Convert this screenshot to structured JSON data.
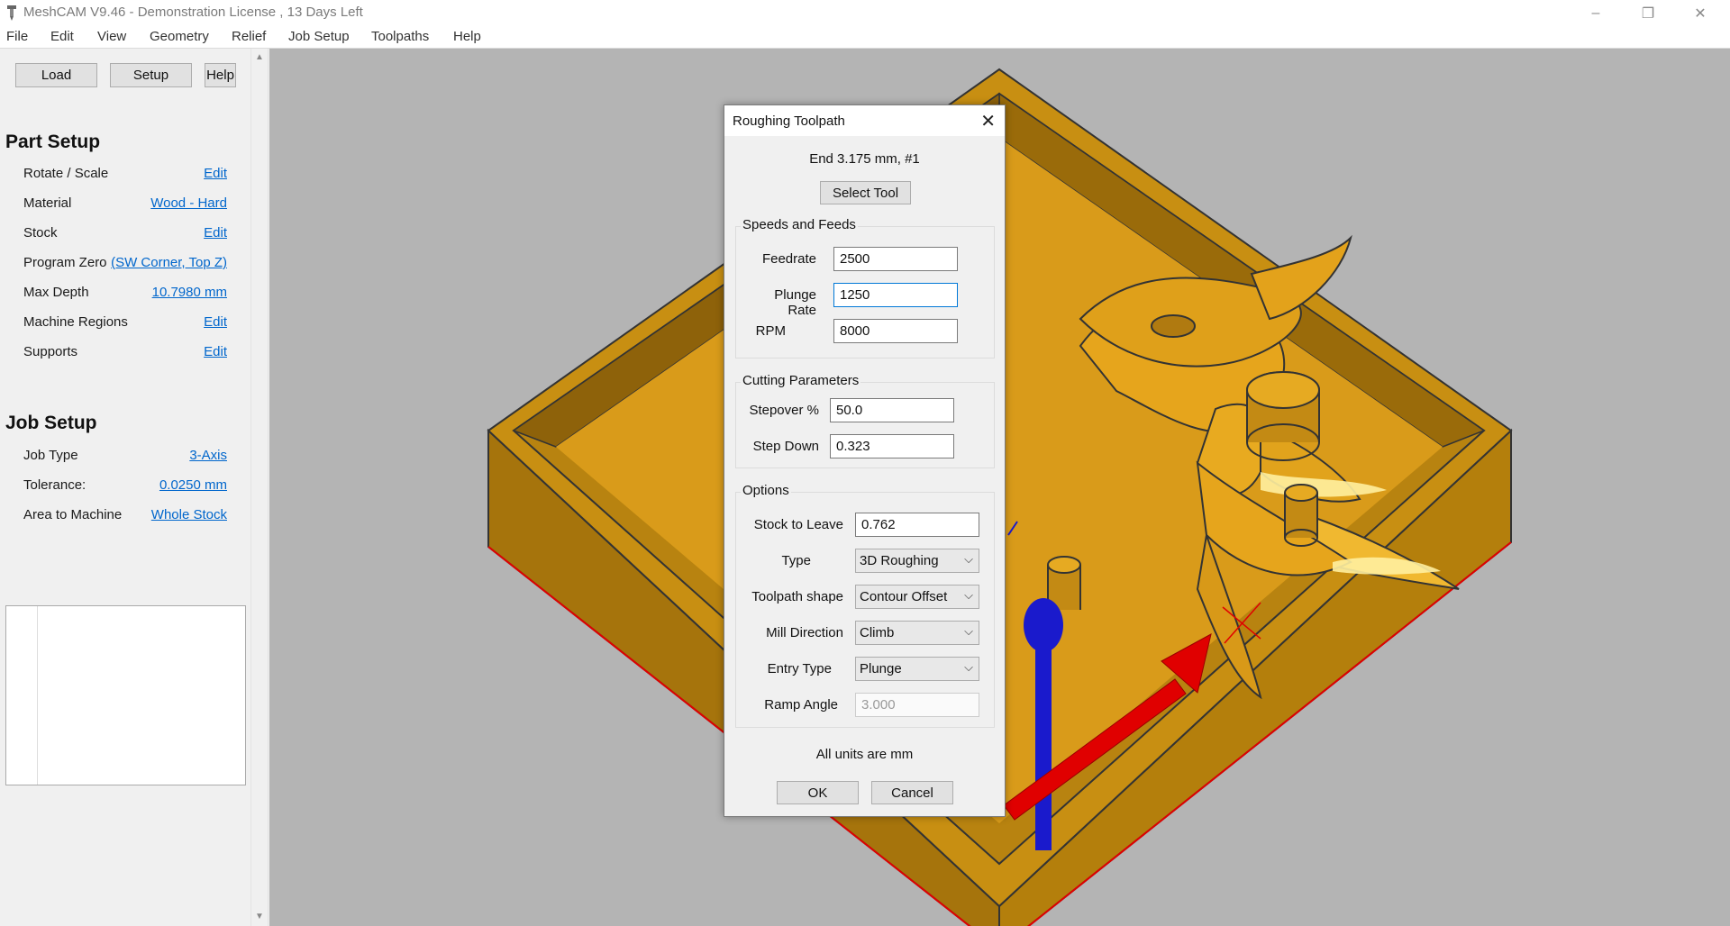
{
  "window": {
    "title": "MeshCAM V9.46 - Demonstration License  , 13 Days Left",
    "controls": [
      "–",
      "❐",
      "✕"
    ]
  },
  "menu": [
    "File",
    "Edit",
    "View",
    "Geometry",
    "Relief",
    "Job Setup",
    "Toolpaths",
    "Help"
  ],
  "toolbar": {
    "load": "Load",
    "setup": "Setup",
    "help": "Help"
  },
  "part_setup": {
    "title": "Part Setup",
    "rows": [
      {
        "label": "Rotate / Scale",
        "value": "Edit"
      },
      {
        "label": "Material",
        "value": "Wood - Hard"
      },
      {
        "label": "Stock",
        "value": "Edit"
      },
      {
        "label": "Program Zero",
        "value": " (SW Corner, Top Z)"
      },
      {
        "label": "Max Depth",
        "value": "10.7980 mm"
      },
      {
        "label": "Machine Regions",
        "value": "Edit"
      },
      {
        "label": "Supports",
        "value": "Edit"
      }
    ]
  },
  "job_setup": {
    "title": "Job Setup",
    "rows": [
      {
        "label": "Job Type",
        "value": "3-Axis"
      },
      {
        "label": "Tolerance:",
        "value": "0.0250 mm"
      },
      {
        "label": "Area to Machine",
        "value": "Whole Stock"
      }
    ]
  },
  "scrollbar": {
    "up": "▲",
    "down": "▼"
  },
  "colors": {
    "stock": "#c8900f",
    "stock_dark": "#9a6b0a",
    "stock_side": "#a8750a",
    "background": "#b4b4b4",
    "x_axis": "#e00000",
    "z_axis": "#1a1acc"
  },
  "dialog": {
    "title": "Roughing Toolpath",
    "close": "✕",
    "tool_info": "End 3.175 mm, #1",
    "select_tool": "Select Tool",
    "speeds": {
      "title": "Speeds and Feeds",
      "feedrate_label": "Feedrate",
      "feedrate": "2500",
      "plunge_label": "Plunge Rate",
      "plunge": "1250",
      "rpm_label": "RPM",
      "rpm": "8000"
    },
    "cutting": {
      "title": "Cutting Parameters",
      "stepover_label": "Stepover %",
      "stepover": "50.0",
      "stepdown_label": "Step Down",
      "stepdown": "0.323"
    },
    "options": {
      "title": "Options",
      "stock_label": "Stock to Leave",
      "stock": "0.762",
      "type_label": "Type",
      "type": "3D Roughing",
      "shape_label": "Toolpath shape",
      "shape": "Contour Offset",
      "mill_label": "Mill Direction",
      "mill": "Climb",
      "entry_label": "Entry Type",
      "entry": "Plunge",
      "ramp_label": "Ramp Angle",
      "ramp": "3.000"
    },
    "units_note": "All units are mm",
    "ok": "OK",
    "cancel": "Cancel"
  }
}
